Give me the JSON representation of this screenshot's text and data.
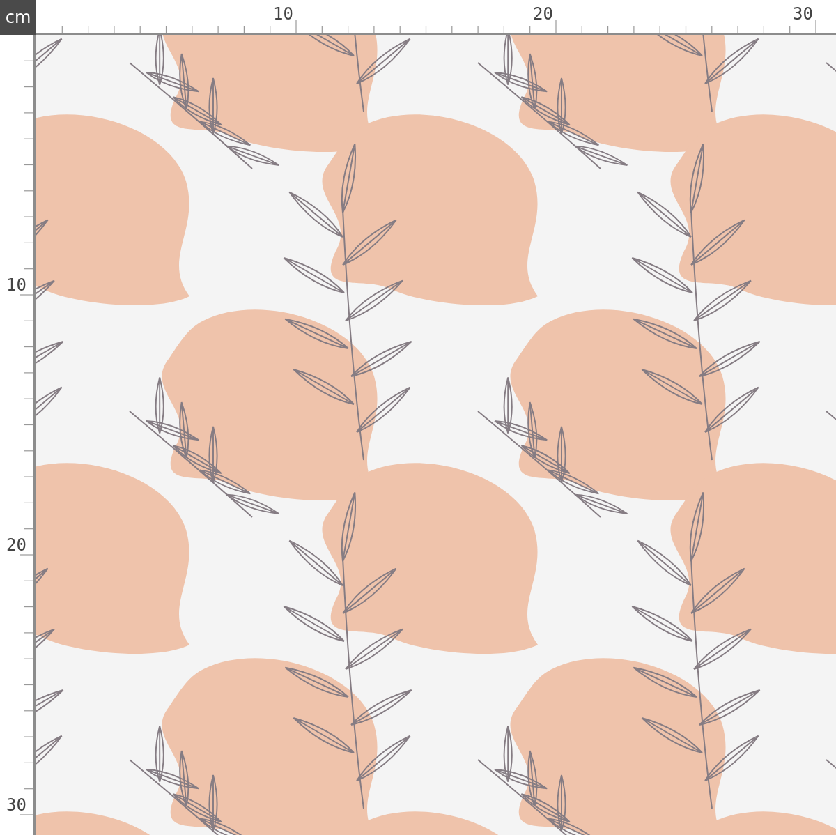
{
  "unit_badge": "cm",
  "ruler_top": {
    "labels": [
      "10",
      "20",
      "30"
    ]
  },
  "ruler_left": {
    "labels": [
      "10",
      "20",
      "30"
    ]
  }
}
